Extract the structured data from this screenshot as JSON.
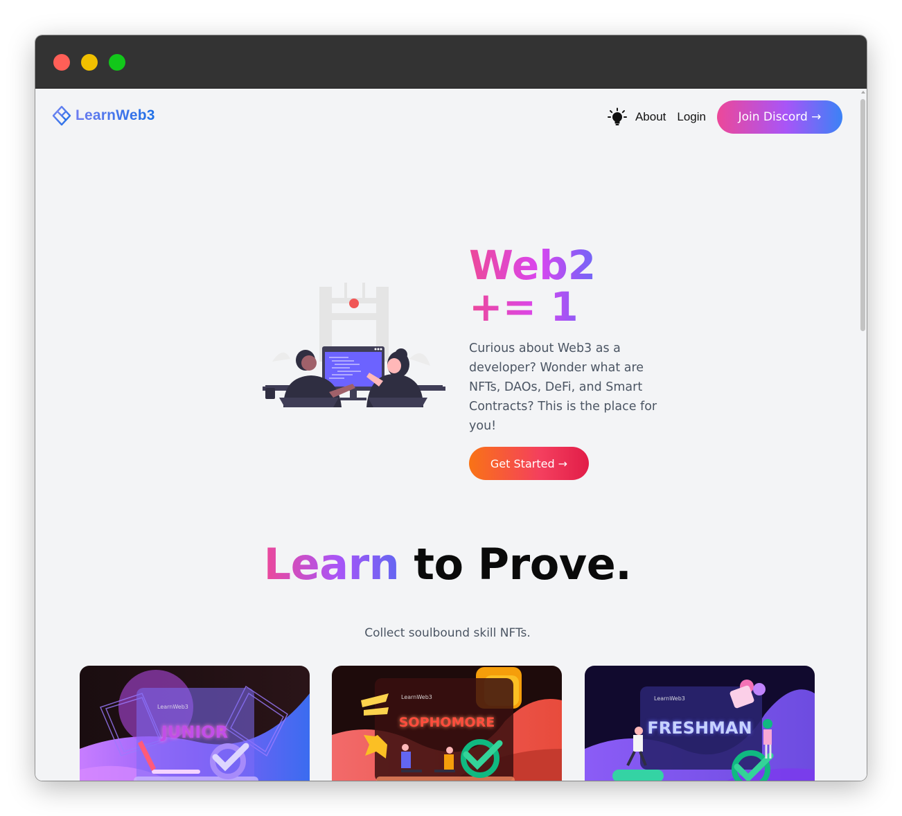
{
  "window": {
    "controls": [
      "close",
      "minimize",
      "maximize"
    ]
  },
  "nav": {
    "logo_text": "LearnWeb3",
    "theme_icon": "lightbulb-icon",
    "links": [
      "About",
      "Login"
    ],
    "discord_label": "Join Discord →"
  },
  "hero": {
    "title": "Web2 += 1",
    "description": "Curious about Web3 as a developer? Wonder what are NFTs, DAOs, DeFi, and Smart Contracts? This is the place for you!",
    "cta_label": "Get Started →"
  },
  "section": {
    "title_accent": "Learn",
    "title_rest": " to Prove.",
    "subtitle": "Collect soulbound skill NFTs."
  },
  "cards": [
    {
      "label": "JUNIOR",
      "badge": "LearnWeb3"
    },
    {
      "label": "SOPHOMORE",
      "badge": "LearnWeb3"
    },
    {
      "label": "FRESHMAN",
      "badge": "LearnWeb3"
    }
  ],
  "colors": {
    "brand_gradient": [
      "#ec4899",
      "#a855f7",
      "#3b82f6"
    ],
    "cta_gradient": [
      "#f97316",
      "#e11d48"
    ],
    "page_bg": "#f3f4f6"
  }
}
